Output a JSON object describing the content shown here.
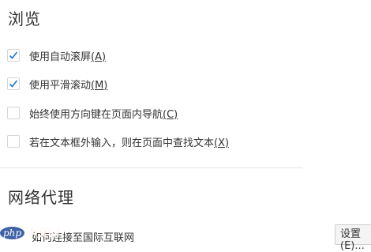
{
  "browse": {
    "heading": "浏览",
    "options": [
      {
        "label": "使用自动滚屏",
        "access_key": "(A)",
        "checked": true
      },
      {
        "label": "使用平滑滚动",
        "access_key": "(M)",
        "checked": true
      },
      {
        "label": "始终使用方向键在页面内导航",
        "access_key": "(C)",
        "checked": false
      },
      {
        "label": "若在文本框外输入，则在页面中查找文本",
        "access_key": "(X)",
        "checked": false
      }
    ]
  },
  "proxy": {
    "heading": "网络代理",
    "description": "如何连接至国际互联网",
    "settings_button_label": "设置(E)..."
  },
  "watermark": {
    "php": "php",
    "site": "中文网"
  },
  "colors": {
    "checkmark": "#1a7ac8",
    "divider": "#e5e5e5",
    "watermark_blue": "#3f62a7",
    "watermark_orange": "#f26d21"
  },
  "icons": {
    "checked": "checkmark-icon"
  }
}
